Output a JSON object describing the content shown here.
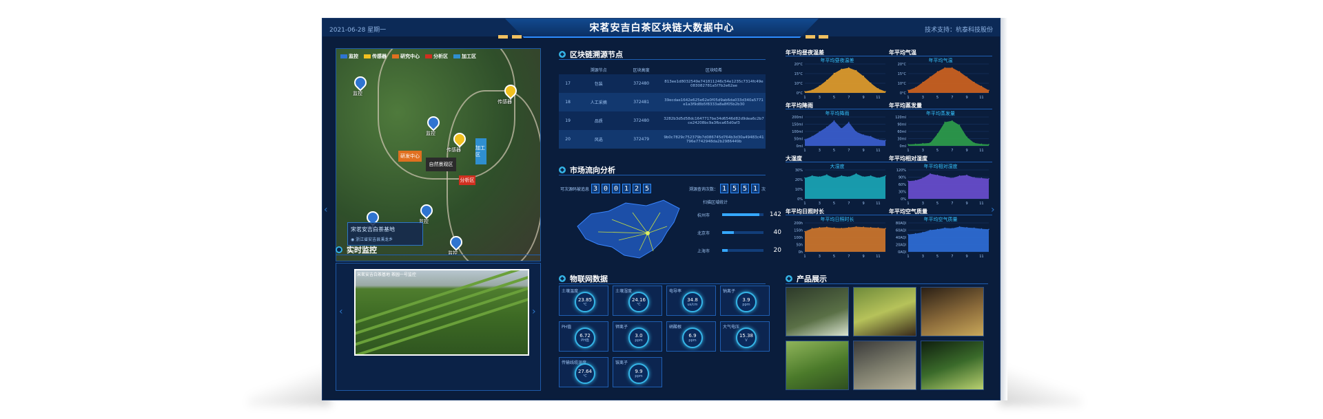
{
  "header": {
    "title": "宋茗安吉白茶区块链大数据中心",
    "date": "2021-06-28 星期一",
    "tech_support": "技术支持：",
    "tech_company": "杭泰科技股份"
  },
  "map": {
    "legend": [
      {
        "label": "监控",
        "color": "#2f74d0"
      },
      {
        "label": "传感器",
        "color": "#f0c020"
      },
      {
        "label": "研究中心",
        "color": "#e07020"
      },
      {
        "label": "分析区",
        "color": "#d03020"
      },
      {
        "label": "加工区",
        "color": "#2f8fd0"
      }
    ],
    "pins": [
      {
        "label": "监控",
        "icon": "camera-icon"
      },
      {
        "label": "传感器",
        "icon": "sensor-icon"
      },
      {
        "label": "监控",
        "icon": "camera-icon"
      },
      {
        "label": "传感器",
        "icon": "sensor-icon"
      },
      {
        "label": "监控",
        "icon": "camera-icon"
      },
      {
        "label": "监控",
        "icon": "camera-icon"
      },
      {
        "label": "监控",
        "icon": "camera-icon"
      }
    ],
    "areas": [
      "研发中心",
      "自然景观区",
      "分析区",
      "加工区"
    ],
    "base_name": "宋茗安吉白茶基地",
    "base_address": "浙江省安吉县溪龙乡"
  },
  "chain": {
    "title": "区块链溯源节点",
    "headers": [
      "溯源节点",
      "区块高度",
      "区块哈希"
    ],
    "rows": [
      {
        "id": "17",
        "node": "包装",
        "height": "372480",
        "hash": "813ee1d8032549e741811246c54e1235c7314fc49e083082781a5f7b2e62ae"
      },
      {
        "id": "18",
        "node": "人工采摘",
        "height": "372481",
        "hash": "39ecdae1642e625e62e0f05d9ab6da033d340a5771e1a3f9d8b5f8333a8a8f05b2b30"
      },
      {
        "id": "19",
        "node": "品质",
        "height": "372480",
        "hash": "3282b3d5d58dc1647717be34d6546d82d9dea6c2b7ce24208bc9a3fbca65d0af3"
      },
      {
        "id": "20",
        "node": "风选",
        "height": "372479",
        "hash": "9b0c7829c752379b7d086745d764b3d30a49483c41796e7742948da2b2986449b"
      }
    ]
  },
  "market": {
    "title": "市场流向分析",
    "trace_label": "可次源码被追息",
    "trace_digits": [
      "3",
      "0",
      "0",
      "1",
      "2",
      "5"
    ],
    "scan_label": "溯源查询次数：",
    "scan_digits": [
      "1",
      "5",
      "5",
      "1"
    ],
    "scan_unit": "次",
    "region_label": "扫描区域统计",
    "stats": [
      {
        "name": "杭州市",
        "value": "142",
        "fraction": 0.9
      },
      {
        "name": "北京市",
        "value": "40",
        "fraction": 0.28
      },
      {
        "name": "上海市",
        "value": "20",
        "fraction": 0.14
      }
    ]
  },
  "charts": [
    {
      "label": "年平均昼夜温差",
      "title": "年平均昼夜温差",
      "color": "#e6a02a",
      "ticks": [
        "20°C",
        "15°C",
        "10°C",
        "0°C"
      ],
      "x": [
        "1",
        "3",
        "5",
        "7",
        "9",
        "11"
      ],
      "values": [
        1,
        2,
        5,
        9,
        14,
        17,
        18,
        16,
        12,
        7,
        3,
        1
      ]
    },
    {
      "label": "年平均气温",
      "title": "年平均气温",
      "color": "#d2641e",
      "ticks": [
        "20°C",
        "15°C",
        "10°C",
        "0°C"
      ],
      "x": [
        "1",
        "3",
        "5",
        "7",
        "9",
        "11"
      ],
      "values": [
        2,
        4,
        8,
        12,
        16,
        19,
        19,
        16,
        12,
        8,
        5,
        2
      ]
    },
    {
      "label": "年平均降雨",
      "title": "年平均降雨",
      "color": "#3b5fd0",
      "ticks": [
        "200ml",
        "150ml",
        "100ml",
        "50ml",
        "0ml"
      ],
      "x": [
        "1",
        "3",
        "5",
        "7",
        "9",
        "11"
      ],
      "values": [
        40,
        60,
        90,
        120,
        160,
        110,
        150,
        90,
        70,
        60,
        40,
        35
      ]
    },
    {
      "label": "年平均蒸发量",
      "title": "年平均蒸发量",
      "color": "#2ea04a",
      "ticks": [
        "120ml",
        "90ml",
        "60ml",
        "30ml",
        "0ml"
      ],
      "x": [
        "1",
        "3",
        "5",
        "7",
        "9",
        "11"
      ],
      "values": [
        5,
        6,
        8,
        10,
        40,
        80,
        85,
        70,
        30,
        10,
        6,
        5
      ]
    },
    {
      "label": "大湿度",
      "title": "大湿度",
      "color": "#1aa8b8",
      "ticks": [
        "30%",
        "20%",
        "10%",
        "0%"
      ],
      "x": [
        "1",
        "3",
        "5",
        "7",
        "9",
        "11"
      ],
      "values": [
        20,
        22,
        21,
        23,
        20,
        22,
        21,
        24,
        21,
        22,
        20,
        22
      ]
    },
    {
      "label": "年平均相对湿度",
      "title": "年平均相对湿度",
      "color": "#6a4fd0",
      "ticks": [
        "120%",
        "90%",
        "60%",
        "30%",
        "0%"
      ],
      "x": [
        "1",
        "3",
        "5",
        "7",
        "9",
        "11"
      ],
      "values": [
        60,
        62,
        70,
        85,
        80,
        75,
        70,
        78,
        80,
        72,
        70,
        68
      ]
    },
    {
      "label": "年平均日照时长",
      "title": "年平均日照时长",
      "color": "#d2782a",
      "ticks": [
        "200h",
        "150h",
        "100h",
        "50h",
        "0h"
      ],
      "x": [
        "1",
        "3",
        "5",
        "7",
        "9",
        "11"
      ],
      "values": [
        100,
        115,
        120,
        122,
        118,
        116,
        120,
        124,
        122,
        120,
        118,
        115
      ]
    },
    {
      "label": "年平均空气质量",
      "title": "年平均空气质量",
      "color": "#2f6fd8",
      "ticks": [
        "80AQI",
        "60AQI",
        "40AQI",
        "20AQI",
        "0AQI"
      ],
      "x": [
        "1",
        "3",
        "5",
        "7",
        "9",
        "11"
      ],
      "values": [
        40,
        42,
        45,
        50,
        52,
        55,
        54,
        58,
        56,
        55,
        53,
        52
      ]
    }
  ],
  "monitor": {
    "title": "实时监控",
    "caption": "宋茗安吉白茶基地 茶园一号监控"
  },
  "iot": {
    "title": "物联网数据",
    "sensors": [
      {
        "name": "土壤温度",
        "value": "23.85",
        "unit": "℃"
      },
      {
        "name": "土壤湿度",
        "value": "24.16",
        "unit": "℃"
      },
      {
        "name": "电导率",
        "value": "34.8",
        "unit": "us/cm"
      },
      {
        "name": "钠离子",
        "value": "3.9",
        "unit": "ppm"
      },
      {
        "name": "PH值",
        "value": "6.72",
        "unit": "PH值"
      },
      {
        "name": "钾离子",
        "value": "3.0",
        "unit": "ppm"
      },
      {
        "name": "硝酸根",
        "value": "6.9",
        "unit": "ppm"
      },
      {
        "name": "大气电压",
        "value": "15.38",
        "unit": "V"
      },
      {
        "name": "传输线缆温度",
        "value": "27.64",
        "unit": "℃"
      },
      {
        "name": "铵离子",
        "value": "9.9",
        "unit": "ppm"
      }
    ]
  },
  "products": {
    "title": "产品展示",
    "items": [
      "product-1",
      "product-2",
      "product-3",
      "product-4",
      "product-5",
      "product-6"
    ]
  }
}
